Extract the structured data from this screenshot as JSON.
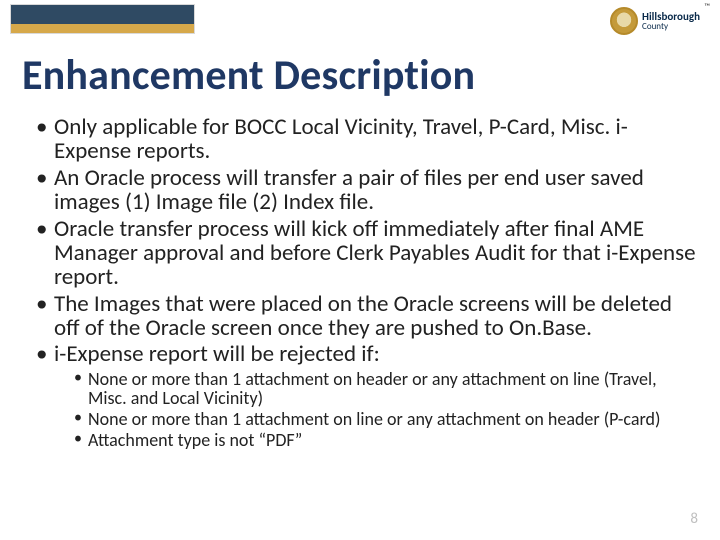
{
  "header": {
    "right_logo_line1": "Hillsborough",
    "right_logo_line2": "County",
    "tm": "™"
  },
  "title": "Enhancement Description",
  "bullets": [
    "Only applicable for BOCC Local Vicinity, Travel, P-Card, Misc. i-Expense reports.",
    "An Oracle process will transfer a pair of files per end user saved images (1) Image file (2) Index file.",
    "Oracle transfer process will kick off immediately after final AME Manager approval and before Clerk Payables Audit for that i-Expense report.",
    "The Images that were placed on the Oracle screens will be deleted off of the Oracle screen once they are pushed to On.Base.",
    "i-Expense report will be rejected if:"
  ],
  "sub_bullets": [
    "None or more than 1 attachment on header or any attachment on line (Travel, Misc. and Local Vicinity)",
    "None or more than 1 attachment on line or any attachment on header (P-card)",
    "Attachment type is not “PDF”"
  ],
  "page_number": "8"
}
